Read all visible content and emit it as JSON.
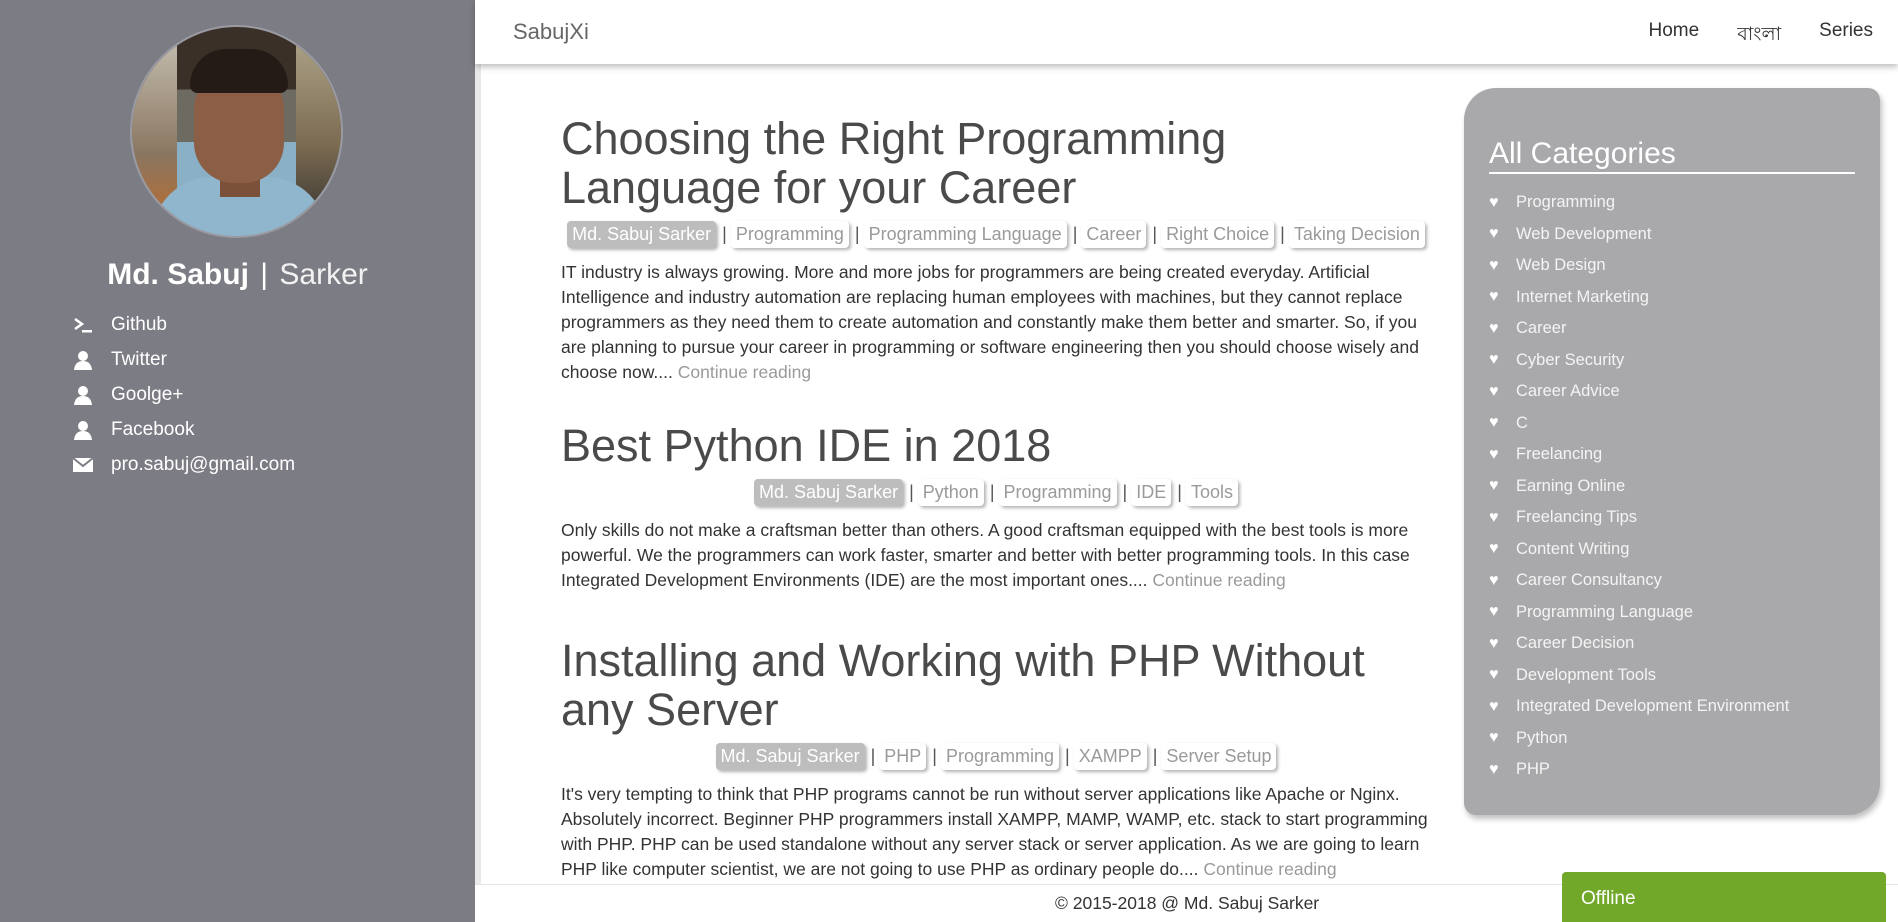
{
  "profile": {
    "first_name": "Md. Sabuj",
    "separator": "|",
    "last_name": "Sarker",
    "links": [
      {
        "icon": "terminal-icon",
        "label": "Github"
      },
      {
        "icon": "user-icon",
        "label": "Twitter"
      },
      {
        "icon": "user-icon",
        "label": "Goolge+"
      },
      {
        "icon": "user-icon",
        "label": "Facebook"
      },
      {
        "icon": "envelope-icon",
        "label": "pro.sabuj@gmail.com"
      }
    ]
  },
  "navbar": {
    "brand": "SabujXi",
    "links": [
      "Home",
      "বাংলা",
      "Series"
    ]
  },
  "posts": [
    {
      "title": "Choosing the Right Programming Language for your Career",
      "author": "Md. Sabuj Sarker",
      "tags": [
        "Programming",
        "Programming Language",
        "Career",
        "Right Choice",
        "Taking Decision"
      ],
      "excerpt": "IT industry is always growing. More and more jobs for programmers are being created everyday. Artificial Intelligence and industry automation are replacing human employees with machines, but they cannot replace programmers as they need them to create automation and constantly make them better and smarter. So, if you are planning to pursue your career in programming or software engineering then you should choose wisely and choose now....",
      "more": "Continue reading"
    },
    {
      "title": "Best Python IDE in 2018",
      "author": "Md. Sabuj Sarker",
      "tags": [
        "Python",
        "Programming",
        "IDE",
        "Tools"
      ],
      "excerpt": "Only skills do not make a craftsman better than others. A good craftsman equipped with the best tools is more powerful. We the programmers can work faster, smarter and better with better programming tools. In this case Integrated Development Environments (IDE) are the most important ones....",
      "more": "Continue reading"
    },
    {
      "title": "Installing and Working with PHP Without any Server",
      "author": "Md. Sabuj Sarker",
      "tags": [
        "PHP",
        "Programming",
        "XAMPP",
        "Server Setup"
      ],
      "excerpt": "It's very tempting to think that PHP programs cannot be run without server applications like Apache or Nginx. Absolutely incorrect. Beginner PHP programmers install XAMPP, MAMP, WAMP, etc. stack to start programming with PHP. PHP can be used standalone without any server stack or server application. As we are going to learn PHP like computer scientist, we are not going to use PHP as ordinary people do....",
      "more": "Continue reading"
    }
  ],
  "categories": {
    "title": "All Categories",
    "items": [
      "Programming",
      "Web Development",
      "Web Design",
      "Internet Marketing",
      "Career",
      "Cyber Security",
      "Career Advice",
      "C",
      "Freelancing",
      "Earning Online",
      "Freelancing Tips",
      "Content Writing",
      "Career Consultancy",
      "Programming Language",
      "Career Decision",
      "Development Tools",
      "Integrated Development Environment",
      "Python",
      "PHP"
    ]
  },
  "footer": {
    "copyright": "© 2015-2018 @ Md. Sabuj Sarker"
  },
  "chat": {
    "status": "Offline"
  },
  "colors": {
    "sidebar_bg": "#7c7c84",
    "categories_bg": "#a9a9ac",
    "offline_bg": "#72a82a"
  }
}
